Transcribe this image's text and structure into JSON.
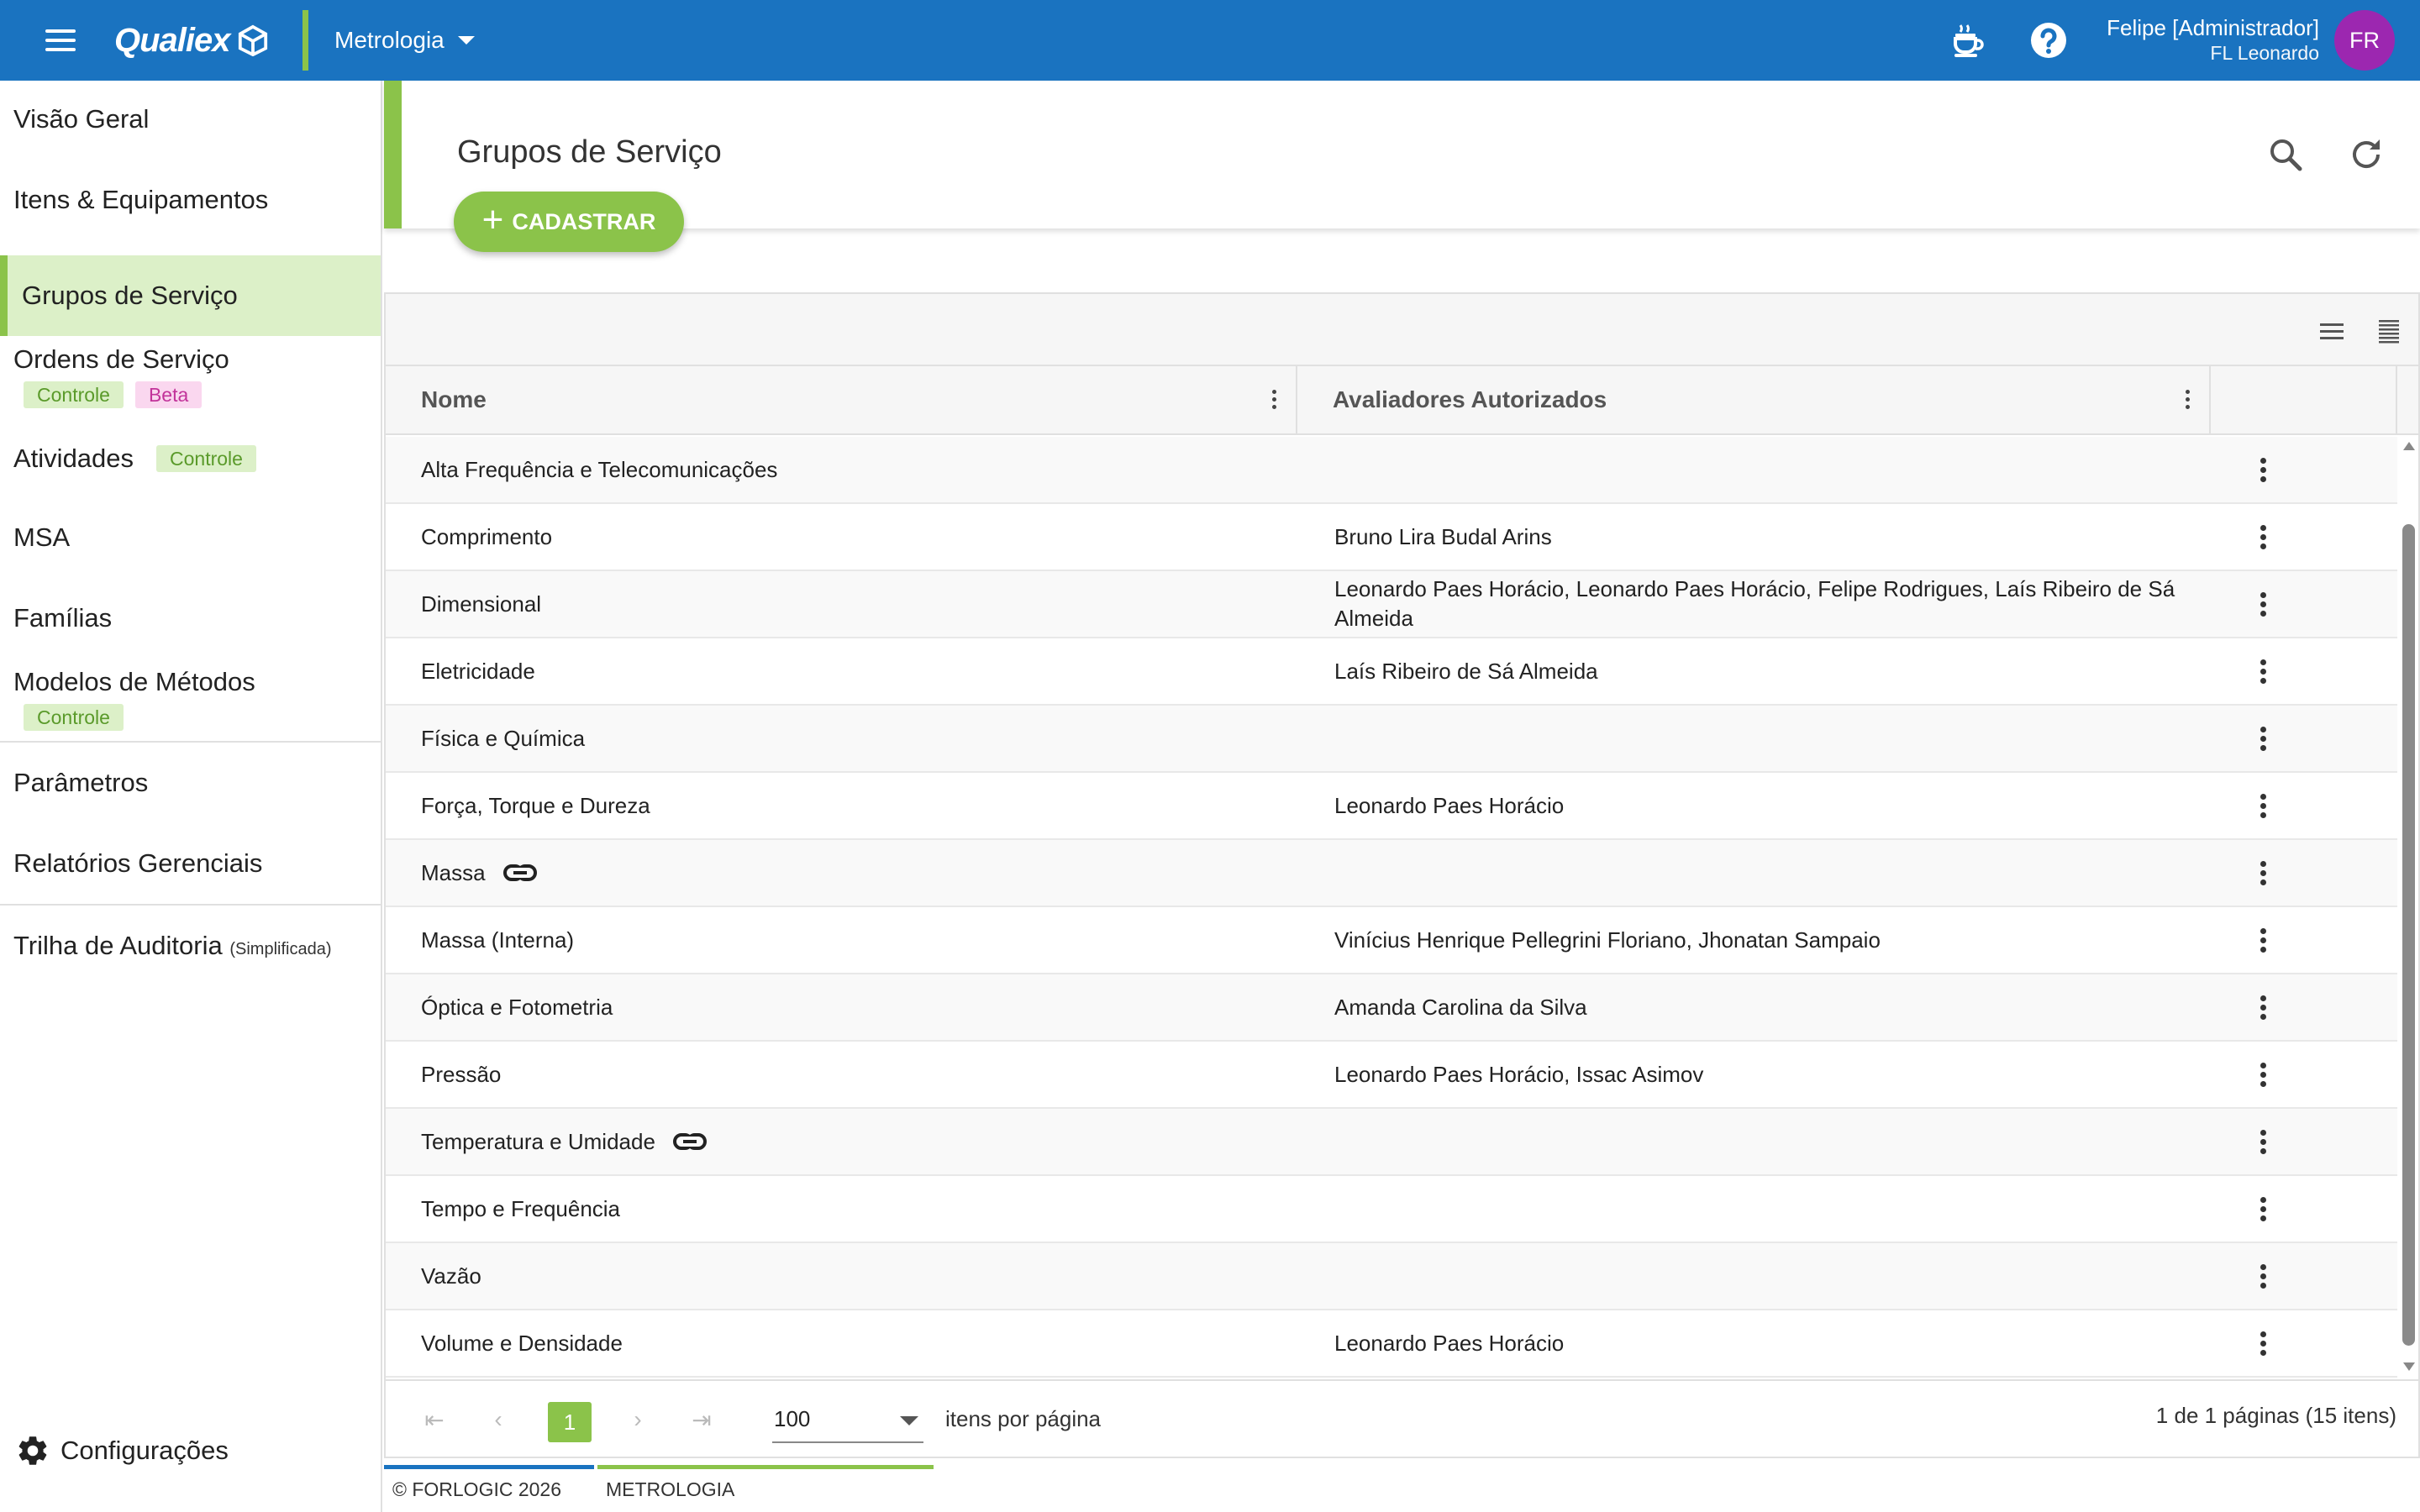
{
  "header": {
    "brand": "Qualiex",
    "module": "Metrologia",
    "user_name": "Felipe [Administrador]",
    "user_company": "FL Leonardo",
    "avatar_initials": "FR",
    "colors": {
      "bar": "#1a73c0",
      "accent": "#8bc34a",
      "avatar": "#9c27b0"
    }
  },
  "sidebar": {
    "items": [
      {
        "label": "Visão Geral"
      },
      {
        "label": "Itens & Equipamentos"
      },
      {
        "label": "Grupos de Serviço",
        "active": true
      },
      {
        "label": "Ordens de Serviço",
        "badges": [
          "Controle",
          "Beta"
        ]
      },
      {
        "label": "Atividades",
        "badges": [
          "Controle"
        ]
      },
      {
        "label": "MSA"
      },
      {
        "label": "Famílias"
      },
      {
        "label": "Modelos de Métodos",
        "badges": [
          "Controle"
        ]
      },
      {
        "label": "Parâmetros"
      },
      {
        "label": "Relatórios Gerenciais"
      },
      {
        "label": "Trilha de Auditoria",
        "tag": "(Simplificada)"
      }
    ],
    "settings_label": "Configurações"
  },
  "page": {
    "title": "Grupos de Serviço",
    "add_button": "CADASTRAR"
  },
  "table": {
    "columns": [
      "Nome",
      "Avaliadores Autorizados"
    ],
    "rows": [
      {
        "nome": "Alta Frequência e Telecomunicações",
        "avaliadores": ""
      },
      {
        "nome": "Comprimento",
        "avaliadores": "Bruno Lira Budal Arins"
      },
      {
        "nome": "Dimensional",
        "avaliadores": "Leonardo Paes Horácio, Leonardo Paes Horácio, Felipe Rodrigues, Laís Ribeiro de Sá Almeida"
      },
      {
        "nome": "Eletricidade",
        "avaliadores": "Laís Ribeiro de Sá Almeida"
      },
      {
        "nome": "Física e Química",
        "avaliadores": ""
      },
      {
        "nome": "Força, Torque e Dureza",
        "avaliadores": "Leonardo Paes Horácio"
      },
      {
        "nome": "Massa",
        "avaliadores": "",
        "linked": true
      },
      {
        "nome": "Massa (Interna)",
        "avaliadores": "Vinícius Henrique Pellegrini Floriano, Jhonatan Sampaio"
      },
      {
        "nome": "Óptica e Fotometria",
        "avaliadores": "Amanda Carolina da Silva"
      },
      {
        "nome": "Pressão",
        "avaliadores": "Leonardo Paes Horácio, Issac Asimov"
      },
      {
        "nome": "Temperatura e Umidade",
        "avaliadores": "",
        "linked": true
      },
      {
        "nome": "Tempo e Frequência",
        "avaliadores": ""
      },
      {
        "nome": "Vazão",
        "avaliadores": ""
      },
      {
        "nome": "Volume e Densidade",
        "avaliadores": "Leonardo Paes Horácio"
      }
    ]
  },
  "pagination": {
    "current_page": "1",
    "page_size": "100",
    "page_size_label": "itens por página",
    "summary": "1 de 1 páginas (15 itens)"
  },
  "footer": {
    "copyright": "© FORLOGIC 2026",
    "module": "METROLOGIA"
  }
}
